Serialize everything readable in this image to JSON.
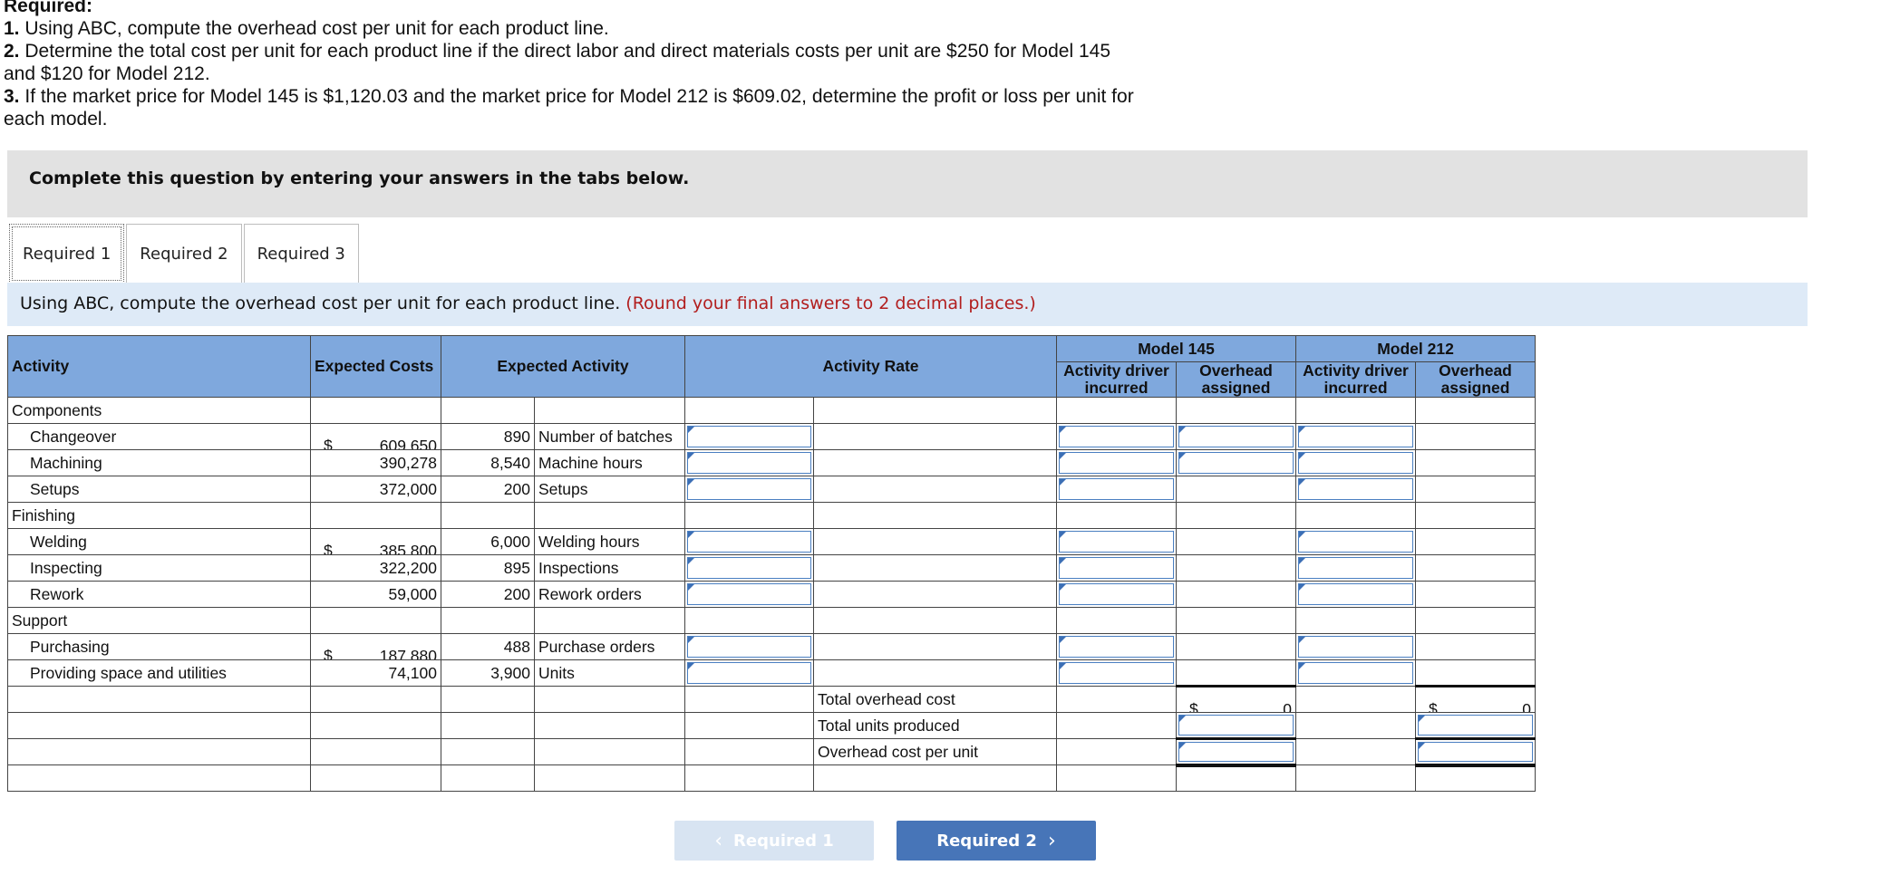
{
  "required": {
    "heading": "Required:",
    "items": [
      {
        "num": "1.",
        "text": "Using ABC, compute the overhead cost per unit for each product line."
      },
      {
        "num": "2.",
        "text": "Determine the total cost per unit for each product line if the direct labor and direct materials costs per unit are $250 for Model 145 and $120 for Model 212."
      },
      {
        "num": "3.",
        "text": "If the market price for Model 145 is $1,120.03 and the market price for Model 212 is $609.02, determine the profit or loss per unit for each model."
      }
    ]
  },
  "banner": "Complete this question by entering your answers in the tabs below.",
  "tabs": [
    "Required 1",
    "Required 2",
    "Required 3"
  ],
  "instruction": {
    "text": "Using ABC, compute the overhead cost per unit for each product line.",
    "hint": "(Round your final answers to 2 decimal places.)"
  },
  "table": {
    "headers": {
      "activity": "Activity",
      "expected_costs": "Expected Costs",
      "expected_activity": "Expected Activity",
      "activity_rate": "Activity Rate",
      "model_145": "Model 145",
      "model_212": "Model 212",
      "driver_incurred": "Activity driver incurred",
      "overhead_assigned": "Overhead assigned"
    },
    "groups": {
      "components": "Components",
      "finishing": "Finishing",
      "support": "Support"
    },
    "rows": {
      "changeover": {
        "name": "Changeover",
        "dollar": "$",
        "cost": "609,650",
        "qty": "890",
        "driver": "Number of batches"
      },
      "machining": {
        "name": "Machining",
        "cost": "390,278",
        "qty": "8,540",
        "driver": "Machine hours"
      },
      "setups": {
        "name": "Setups",
        "cost": "372,000",
        "qty": "200",
        "driver": "Setups"
      },
      "welding": {
        "name": "Welding",
        "dollar": "$",
        "cost": "385,800",
        "qty": "6,000",
        "driver": "Welding hours"
      },
      "inspecting": {
        "name": "Inspecting",
        "cost": "322,200",
        "qty": "895",
        "driver": "Inspections"
      },
      "rework": {
        "name": "Rework",
        "cost": "59,000",
        "qty": "200",
        "driver": "Rework orders"
      },
      "purchasing": {
        "name": "Purchasing",
        "dollar": "$",
        "cost": "187,880",
        "qty": "488",
        "driver": "Purchase orders"
      },
      "space": {
        "name": "Providing space and utilities",
        "cost": "74,100",
        "qty": "3,900",
        "driver": "Units"
      }
    },
    "totals": {
      "total_overhead": "Total overhead cost",
      "total_units": "Total units produced",
      "per_unit": "Overhead cost per unit",
      "dollar": "$",
      "m145_total": "0",
      "m212_total": "0"
    }
  },
  "nav": {
    "prev": "Required 1",
    "next": "Required 2"
  }
}
